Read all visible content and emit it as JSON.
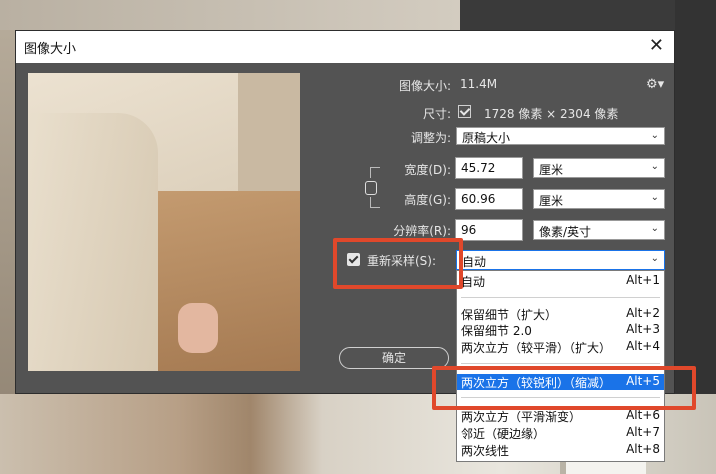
{
  "dialog": {
    "title": "图像大小",
    "close_glyph": "✕",
    "gear_glyph": "⚙▾"
  },
  "info": {
    "image_size_label": "图像大小:",
    "image_size_value": "11.4M",
    "dimensions_label": "尺寸:",
    "dimensions_value": "1728 像素 × 2304 像素",
    "fit_label": "调整为:",
    "fit_value": "原稿大小"
  },
  "fields": {
    "width_label": "宽度(D):",
    "width_value": "45.72",
    "width_unit": "厘米",
    "height_label": "高度(G):",
    "height_value": "60.96",
    "height_unit": "厘米",
    "resolution_label": "分辨率(R):",
    "resolution_value": "96",
    "resolution_unit": "像素/英寸"
  },
  "resample": {
    "label": "重新采样(S):",
    "checked": true,
    "value": "自动"
  },
  "buttons": {
    "ok": "确定"
  },
  "dropdown": {
    "options": [
      {
        "label": "自动",
        "shortcut": "Alt+1"
      },
      {
        "label": "保留细节（扩大）",
        "shortcut": "Alt+2"
      },
      {
        "label": "保留细节 2.0",
        "shortcut": "Alt+3"
      },
      {
        "label": "两次立方（较平滑）（扩大）",
        "shortcut": "Alt+4"
      },
      {
        "label": "两次立方（较锐利）（缩减）",
        "shortcut": "Alt+5"
      },
      {
        "label": "两次立方（平滑渐变）",
        "shortcut": "Alt+6"
      },
      {
        "label": "邻近（硬边缘）",
        "shortcut": "Alt+7"
      },
      {
        "label": "两次线性",
        "shortcut": "Alt+8"
      }
    ],
    "selected_index": 4
  },
  "colors": {
    "dialog_bg": "#535353",
    "highlight_red": "#e0482b",
    "selection_blue": "#1a73e8"
  }
}
